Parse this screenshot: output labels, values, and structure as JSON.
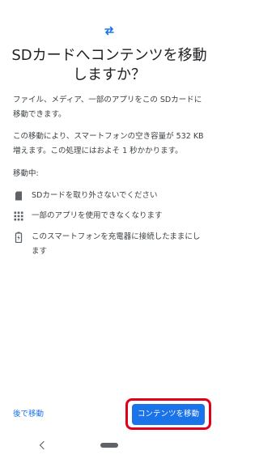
{
  "icons": {
    "header": "swap-arrows-icon",
    "item1": "sd-card-icon",
    "item2": "apps-grid-icon",
    "item3": "battery-charging-icon",
    "back": "back-chevron-icon",
    "home": "home-pill"
  },
  "colors": {
    "accent": "#1a73e8",
    "highlight": "#e0001b",
    "text": "#3c4043"
  },
  "dialog": {
    "title": "SDカードへコンテンツを移動しますか？",
    "description": "ファイル、メディア、一部のアプリをこの SDカードに移動できます。",
    "storage_note": "この移動により、スマートフォンの空き容量が 532 KB 増えます。この処理にはおよそ 1 秒かかります。",
    "moving_label": "移動中:",
    "items": [
      {
        "text": "SDカードを取り外さないでください"
      },
      {
        "text": "一部のアプリを使用できなくなります"
      },
      {
        "text": "このスマートフォンを充電器に接続したままにします"
      }
    ],
    "later_button": "後で移動",
    "move_button": "コンテンツを移動"
  }
}
